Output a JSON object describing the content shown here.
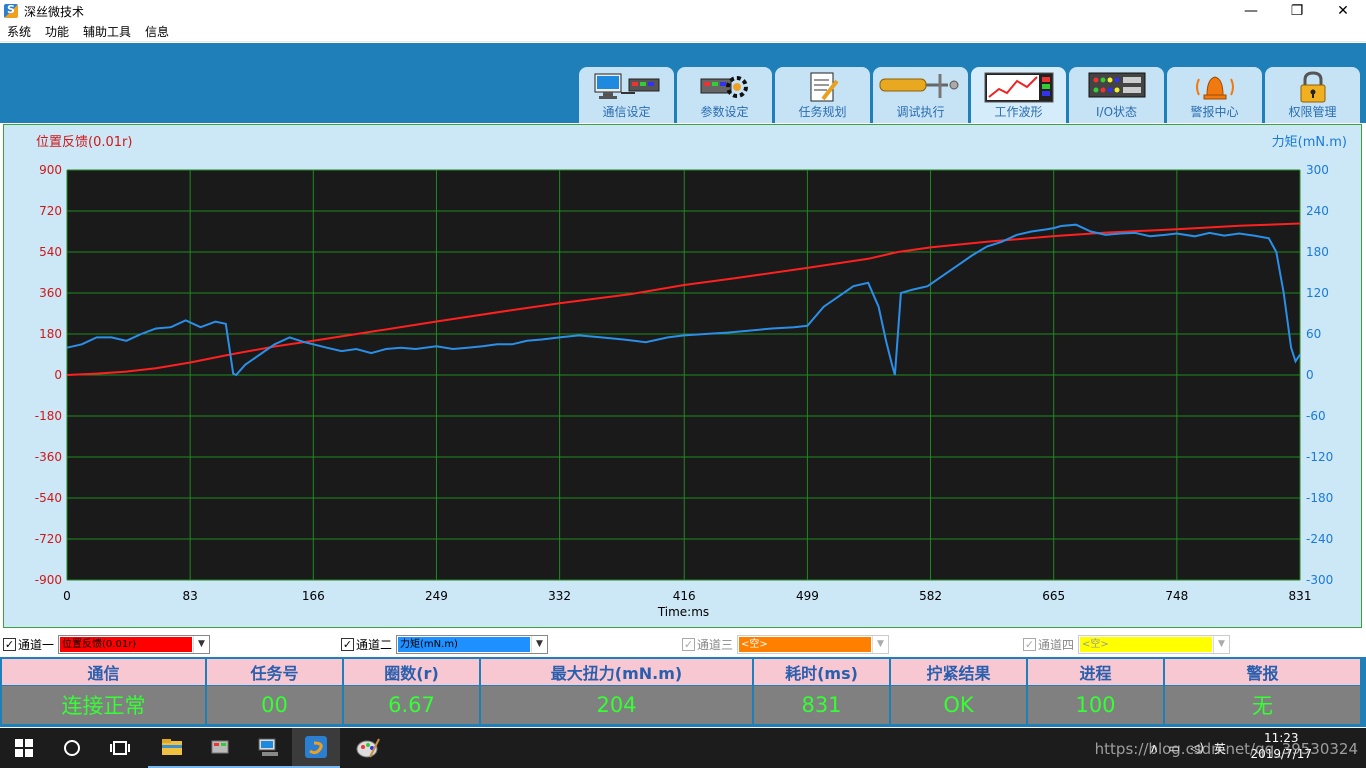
{
  "window": {
    "title": "深丝微技术",
    "minimize_glyph": "—",
    "maximize_glyph": "❐",
    "close_glyph": "✕"
  },
  "menu": [
    "系统",
    "功能",
    "辅助工具",
    "信息"
  ],
  "toolbar": {
    "tabs": [
      {
        "label": "通信设定",
        "icon": "computer-network-icon"
      },
      {
        "label": "参数设定",
        "icon": "gear-settings-icon"
      },
      {
        "label": "任务规划",
        "icon": "document-pen-icon"
      },
      {
        "label": "调试执行",
        "icon": "screwdriver-icon"
      },
      {
        "label": "工作波形",
        "icon": "waveform-chart-icon"
      },
      {
        "label": "I/O状态",
        "icon": "io-panel-icon"
      },
      {
        "label": "警报中心",
        "icon": "alarm-bell-icon"
      },
      {
        "label": "权限管理",
        "icon": "padlock-icon"
      }
    ]
  },
  "chart": {
    "left_axis_title": "位置反馈(0.01r)",
    "right_axis_title": "力矩(mN.m)",
    "x_axis_title": "Time:ms",
    "colors": {
      "series1": "#ff2020",
      "series2": "#2b8fe8",
      "background": "#1a1a1a",
      "grid": "#1f8a1f",
      "left_ticks": "#d01818",
      "right_ticks": "#1a7ad8"
    }
  },
  "chart_data": {
    "type": "line",
    "title": "",
    "xlabel": "Time:ms",
    "x_ticks": [
      0,
      83,
      166,
      249,
      332,
      416,
      499,
      582,
      665,
      748,
      831
    ],
    "xlim": [
      0,
      831
    ],
    "y_left": {
      "label": "位置反馈(0.01r)",
      "ticks": [
        900,
        720,
        540,
        360,
        180,
        0,
        -180,
        -360,
        -540,
        -720,
        -900
      ],
      "ylim": [
        -900,
        900
      ]
    },
    "y_right": {
      "label": "力矩(mN.m)",
      "ticks": [
        300,
        240,
        180,
        120,
        60,
        0,
        -60,
        -120,
        -180,
        -240,
        -300
      ],
      "ylim": [
        -300,
        300
      ]
    },
    "grid": true,
    "series": [
      {
        "name": "位置反馈(0.01r)",
        "axis": "left",
        "x": [
          0,
          20,
          40,
          60,
          83,
          110,
          140,
          166,
          200,
          249,
          300,
          332,
          380,
          416,
          450,
          499,
          540,
          560,
          582,
          620,
          665,
          700,
          748,
          790,
          831
        ],
        "y": [
          0,
          6,
          15,
          30,
          55,
          90,
          125,
          150,
          185,
          235,
          285,
          315,
          355,
          395,
          425,
          470,
          510,
          540,
          560,
          585,
          610,
          625,
          640,
          655,
          665
        ]
      },
      {
        "name": "力矩(mN.m)",
        "axis": "right",
        "x": [
          0,
          10,
          20,
          30,
          40,
          50,
          60,
          70,
          80,
          90,
          100,
          107,
          112,
          114,
          120,
          130,
          140,
          150,
          160,
          166,
          175,
          185,
          195,
          205,
          215,
          225,
          235,
          249,
          260,
          270,
          280,
          290,
          300,
          310,
          320,
          332,
          345,
          360,
          375,
          390,
          405,
          416,
          430,
          445,
          460,
          475,
          490,
          499,
          510,
          520,
          530,
          540,
          547,
          552,
          556,
          558,
          562,
          570,
          580,
          590,
          600,
          610,
          620,
          630,
          640,
          650,
          660,
          665,
          670,
          680,
          690,
          700,
          710,
          720,
          730,
          740,
          748,
          760,
          770,
          780,
          790,
          800,
          810,
          815,
          820,
          825,
          828,
          831
        ],
        "y": [
          40,
          45,
          55,
          55,
          50,
          60,
          68,
          70,
          80,
          70,
          78,
          75,
          2,
          0,
          15,
          30,
          45,
          55,
          48,
          45,
          40,
          35,
          38,
          32,
          38,
          40,
          38,
          42,
          38,
          40,
          42,
          45,
          45,
          50,
          52,
          55,
          58,
          55,
          52,
          48,
          55,
          58,
          60,
          62,
          65,
          68,
          70,
          72,
          100,
          115,
          130,
          135,
          100,
          50,
          15,
          0,
          120,
          125,
          130,
          145,
          160,
          175,
          188,
          195,
          205,
          210,
          213,
          215,
          218,
          220,
          210,
          205,
          207,
          208,
          203,
          205,
          207,
          203,
          208,
          204,
          207,
          204,
          200,
          180,
          120,
          40,
          20,
          30
        ]
      }
    ]
  },
  "channels": [
    {
      "label": "通道一",
      "checked": true,
      "enabled": true,
      "value": "位置反馈(0.01r)",
      "color": "#ff0000",
      "text_color": "#000000"
    },
    {
      "label": "通道二",
      "checked": true,
      "enabled": true,
      "value": "力矩(mN.m)",
      "color": "#1e90ff",
      "text_color": "#000000"
    },
    {
      "label": "通道三",
      "checked": true,
      "enabled": false,
      "value": "<空>",
      "color": "#ff8000",
      "text_color": "#ffffff"
    },
    {
      "label": "通道四",
      "checked": true,
      "enabled": false,
      "value": "<空>",
      "color": "#ffff00",
      "text_color": "#999999"
    }
  ],
  "status": [
    {
      "header": "通信",
      "value": "连接正常"
    },
    {
      "header": "任务号",
      "value": "00"
    },
    {
      "header": "圈数(r)",
      "value": "6.67"
    },
    {
      "header": "最大扭力(mN.m)",
      "value": "204"
    },
    {
      "header": "耗时(ms)",
      "value": "831"
    },
    {
      "header": "拧紧结果",
      "value": "OK"
    },
    {
      "header": "进程",
      "value": "100"
    },
    {
      "header": "警报",
      "value": "无"
    }
  ],
  "taskbar": {
    "icons": [
      "windows-start-icon",
      "search-circle-icon",
      "task-view-icon",
      "file-explorer-icon",
      "app-server-icon",
      "app-network-icon",
      "shensi-app-icon",
      "paint-app-icon"
    ],
    "tray": [
      "∧",
      "▭",
      "◁)",
      "英"
    ],
    "time": "11:23",
    "date": "2019/7/17",
    "watermark": "https://blog.csdn.net/qq_39530324"
  }
}
